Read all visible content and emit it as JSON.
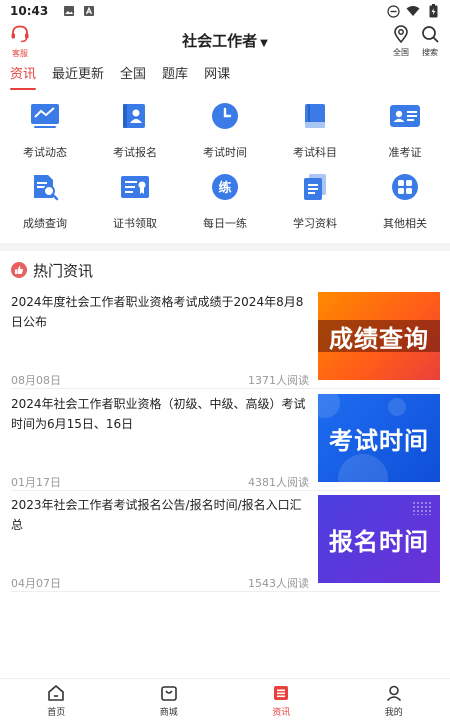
{
  "status_bar": {
    "time": "10:43"
  },
  "header": {
    "service_label": "客服",
    "title": "社会工作者",
    "location_label": "全国",
    "search_label": "搜索"
  },
  "tabs": [
    "资讯",
    "最近更新",
    "全国",
    "题库",
    "网课"
  ],
  "grid": [
    {
      "label": "考试动态",
      "icon": "trend-chart-icon"
    },
    {
      "label": "考试报名",
      "icon": "register-icon"
    },
    {
      "label": "考试时间",
      "icon": "clock-icon"
    },
    {
      "label": "考试科目",
      "icon": "book-icon"
    },
    {
      "label": "准考证",
      "icon": "id-card-icon"
    },
    {
      "label": "成绩查询",
      "icon": "score-search-icon"
    },
    {
      "label": "证书领取",
      "icon": "certificate-icon"
    },
    {
      "label": "每日一练",
      "icon": "daily-practice-icon"
    },
    {
      "label": "学习资料",
      "icon": "documents-icon"
    },
    {
      "label": "其他相关",
      "icon": "apps-icon"
    }
  ],
  "hot": {
    "title": "热门资讯"
  },
  "news": [
    {
      "title": "2024年度社会工作者职业资格考试成绩于2024年8月8日公布",
      "date": "08月08日",
      "reads": "1371人阅读",
      "image_text": "成绩查询"
    },
    {
      "title": "2024年社会工作者职业资格（初级、中级、高级）考试时间为6月15日、16日",
      "date": "01月17日",
      "reads": "4381人阅读",
      "image_text": "考试时间"
    },
    {
      "title": "2023年社会工作者考试报名公告/报名时间/报名入口汇总",
      "date": "04月07日",
      "reads": "1543人阅读",
      "image_text": "报名时间"
    }
  ],
  "bottom_nav": [
    "首页",
    "商城",
    "资讯",
    "我的"
  ],
  "colors": {
    "accent": "#e8413c",
    "icon_blue": "#3a7be8"
  }
}
